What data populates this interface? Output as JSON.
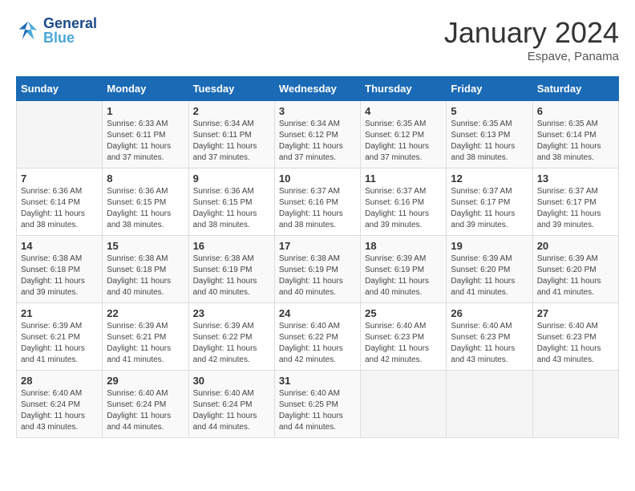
{
  "header": {
    "logo_general": "General",
    "logo_blue": "Blue",
    "month_title": "January 2024",
    "location": "Espave, Panama"
  },
  "days_of_week": [
    "Sunday",
    "Monday",
    "Tuesday",
    "Wednesday",
    "Thursday",
    "Friday",
    "Saturday"
  ],
  "weeks": [
    [
      {
        "day": "",
        "sunrise": "",
        "sunset": "",
        "daylight": ""
      },
      {
        "day": "1",
        "sunrise": "Sunrise: 6:33 AM",
        "sunset": "Sunset: 6:11 PM",
        "daylight": "Daylight: 11 hours and 37 minutes."
      },
      {
        "day": "2",
        "sunrise": "Sunrise: 6:34 AM",
        "sunset": "Sunset: 6:11 PM",
        "daylight": "Daylight: 11 hours and 37 minutes."
      },
      {
        "day": "3",
        "sunrise": "Sunrise: 6:34 AM",
        "sunset": "Sunset: 6:12 PM",
        "daylight": "Daylight: 11 hours and 37 minutes."
      },
      {
        "day": "4",
        "sunrise": "Sunrise: 6:35 AM",
        "sunset": "Sunset: 6:12 PM",
        "daylight": "Daylight: 11 hours and 37 minutes."
      },
      {
        "day": "5",
        "sunrise": "Sunrise: 6:35 AM",
        "sunset": "Sunset: 6:13 PM",
        "daylight": "Daylight: 11 hours and 38 minutes."
      },
      {
        "day": "6",
        "sunrise": "Sunrise: 6:35 AM",
        "sunset": "Sunset: 6:14 PM",
        "daylight": "Daylight: 11 hours and 38 minutes."
      }
    ],
    [
      {
        "day": "7",
        "sunrise": "Sunrise: 6:36 AM",
        "sunset": "Sunset: 6:14 PM",
        "daylight": "Daylight: 11 hours and 38 minutes."
      },
      {
        "day": "8",
        "sunrise": "Sunrise: 6:36 AM",
        "sunset": "Sunset: 6:15 PM",
        "daylight": "Daylight: 11 hours and 38 minutes."
      },
      {
        "day": "9",
        "sunrise": "Sunrise: 6:36 AM",
        "sunset": "Sunset: 6:15 PM",
        "daylight": "Daylight: 11 hours and 38 minutes."
      },
      {
        "day": "10",
        "sunrise": "Sunrise: 6:37 AM",
        "sunset": "Sunset: 6:16 PM",
        "daylight": "Daylight: 11 hours and 38 minutes."
      },
      {
        "day": "11",
        "sunrise": "Sunrise: 6:37 AM",
        "sunset": "Sunset: 6:16 PM",
        "daylight": "Daylight: 11 hours and 39 minutes."
      },
      {
        "day": "12",
        "sunrise": "Sunrise: 6:37 AM",
        "sunset": "Sunset: 6:17 PM",
        "daylight": "Daylight: 11 hours and 39 minutes."
      },
      {
        "day": "13",
        "sunrise": "Sunrise: 6:37 AM",
        "sunset": "Sunset: 6:17 PM",
        "daylight": "Daylight: 11 hours and 39 minutes."
      }
    ],
    [
      {
        "day": "14",
        "sunrise": "Sunrise: 6:38 AM",
        "sunset": "Sunset: 6:18 PM",
        "daylight": "Daylight: 11 hours and 39 minutes."
      },
      {
        "day": "15",
        "sunrise": "Sunrise: 6:38 AM",
        "sunset": "Sunset: 6:18 PM",
        "daylight": "Daylight: 11 hours and 40 minutes."
      },
      {
        "day": "16",
        "sunrise": "Sunrise: 6:38 AM",
        "sunset": "Sunset: 6:19 PM",
        "daylight": "Daylight: 11 hours and 40 minutes."
      },
      {
        "day": "17",
        "sunrise": "Sunrise: 6:38 AM",
        "sunset": "Sunset: 6:19 PM",
        "daylight": "Daylight: 11 hours and 40 minutes."
      },
      {
        "day": "18",
        "sunrise": "Sunrise: 6:39 AM",
        "sunset": "Sunset: 6:19 PM",
        "daylight": "Daylight: 11 hours and 40 minutes."
      },
      {
        "day": "19",
        "sunrise": "Sunrise: 6:39 AM",
        "sunset": "Sunset: 6:20 PM",
        "daylight": "Daylight: 11 hours and 41 minutes."
      },
      {
        "day": "20",
        "sunrise": "Sunrise: 6:39 AM",
        "sunset": "Sunset: 6:20 PM",
        "daylight": "Daylight: 11 hours and 41 minutes."
      }
    ],
    [
      {
        "day": "21",
        "sunrise": "Sunrise: 6:39 AM",
        "sunset": "Sunset: 6:21 PM",
        "daylight": "Daylight: 11 hours and 41 minutes."
      },
      {
        "day": "22",
        "sunrise": "Sunrise: 6:39 AM",
        "sunset": "Sunset: 6:21 PM",
        "daylight": "Daylight: 11 hours and 41 minutes."
      },
      {
        "day": "23",
        "sunrise": "Sunrise: 6:39 AM",
        "sunset": "Sunset: 6:22 PM",
        "daylight": "Daylight: 11 hours and 42 minutes."
      },
      {
        "day": "24",
        "sunrise": "Sunrise: 6:40 AM",
        "sunset": "Sunset: 6:22 PM",
        "daylight": "Daylight: 11 hours and 42 minutes."
      },
      {
        "day": "25",
        "sunrise": "Sunrise: 6:40 AM",
        "sunset": "Sunset: 6:23 PM",
        "daylight": "Daylight: 11 hours and 42 minutes."
      },
      {
        "day": "26",
        "sunrise": "Sunrise: 6:40 AM",
        "sunset": "Sunset: 6:23 PM",
        "daylight": "Daylight: 11 hours and 43 minutes."
      },
      {
        "day": "27",
        "sunrise": "Sunrise: 6:40 AM",
        "sunset": "Sunset: 6:23 PM",
        "daylight": "Daylight: 11 hours and 43 minutes."
      }
    ],
    [
      {
        "day": "28",
        "sunrise": "Sunrise: 6:40 AM",
        "sunset": "Sunset: 6:24 PM",
        "daylight": "Daylight: 11 hours and 43 minutes."
      },
      {
        "day": "29",
        "sunrise": "Sunrise: 6:40 AM",
        "sunset": "Sunset: 6:24 PM",
        "daylight": "Daylight: 11 hours and 44 minutes."
      },
      {
        "day": "30",
        "sunrise": "Sunrise: 6:40 AM",
        "sunset": "Sunset: 6:24 PM",
        "daylight": "Daylight: 11 hours and 44 minutes."
      },
      {
        "day": "31",
        "sunrise": "Sunrise: 6:40 AM",
        "sunset": "Sunset: 6:25 PM",
        "daylight": "Daylight: 11 hours and 44 minutes."
      },
      {
        "day": "",
        "sunrise": "",
        "sunset": "",
        "daylight": ""
      },
      {
        "day": "",
        "sunrise": "",
        "sunset": "",
        "daylight": ""
      },
      {
        "day": "",
        "sunrise": "",
        "sunset": "",
        "daylight": ""
      }
    ]
  ]
}
